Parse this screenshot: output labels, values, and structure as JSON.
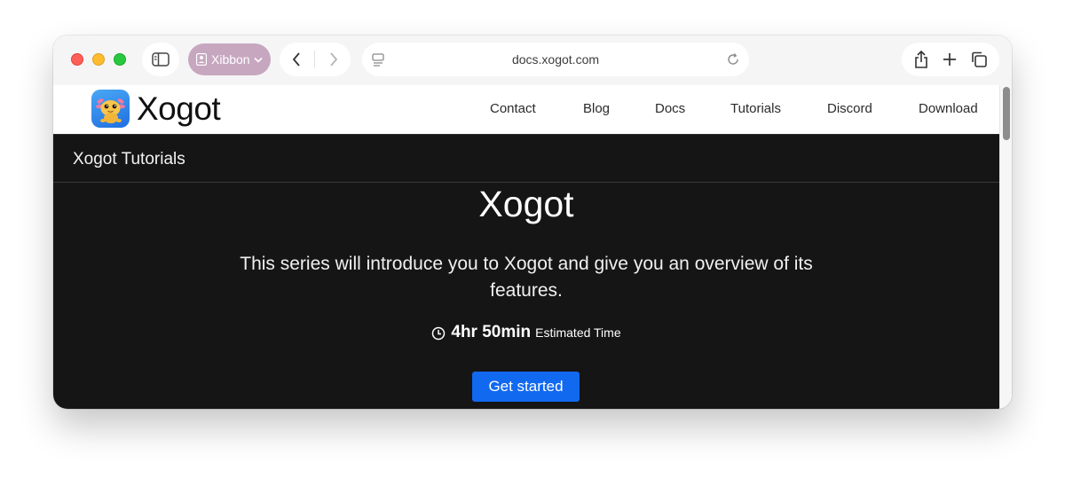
{
  "browser": {
    "profile_name": "Xibbon",
    "url": "docs.xogot.com",
    "icons": {
      "sidebar": "sidebar-icon",
      "profile": "profile-icon",
      "back": "chevron-left-icon",
      "forward": "chevron-right-icon",
      "page": "page-menu-icon",
      "reload": "reload-icon",
      "share": "share-icon",
      "new_tab": "plus-icon",
      "tabs": "tab-overview-icon"
    }
  },
  "site": {
    "logo_text": "Xogot",
    "nav": [
      "Contact",
      "Blog",
      "Docs",
      "Tutorials",
      "Discord",
      "Download"
    ]
  },
  "page": {
    "breadcrumb_title": "Xogot Tutorials",
    "hero_title": "Xogot",
    "description": "This series will introduce you to Xogot and give you an overview of its features.",
    "time_value": "4hr 50min",
    "time_label": "Estimated Time",
    "cta_label": "Get started"
  },
  "colors": {
    "accent": "#1169f0",
    "dark_bg": "#151515",
    "profile_pill": "#c7a7c0"
  }
}
